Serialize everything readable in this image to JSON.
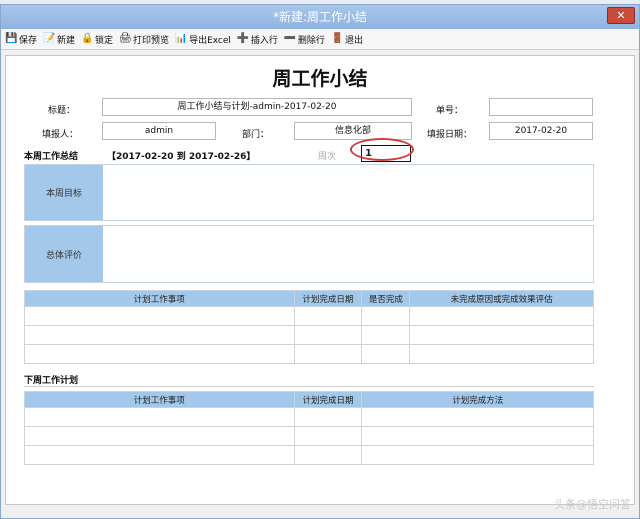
{
  "window": {
    "title": "*新建:周工作小结",
    "close_label": "✕"
  },
  "toolbar": [
    {
      "name": "save",
      "icon": "save-icon",
      "glyph": "💾",
      "label": "保存"
    },
    {
      "name": "new",
      "icon": "new-doc-icon",
      "glyph": "📝",
      "label": "新建"
    },
    {
      "name": "lock",
      "icon": "lock-icon",
      "glyph": "🔒",
      "label": "锁定"
    },
    {
      "name": "print-preview",
      "icon": "print-preview-icon",
      "glyph": "🖨",
      "label": "打印预览"
    },
    {
      "name": "export-excel",
      "icon": "excel-icon",
      "glyph": "📊",
      "label": "导出Excel"
    },
    {
      "name": "insert-row",
      "icon": "insert-row-icon",
      "glyph": "➕",
      "label": "插入行"
    },
    {
      "name": "delete-row",
      "icon": "delete-row-icon",
      "glyph": "➖",
      "label": "删除行"
    },
    {
      "name": "exit",
      "icon": "exit-icon",
      "glyph": "🚪",
      "label": "退出"
    }
  ],
  "form": {
    "heading": "周工作小结",
    "title_label": "标题：",
    "title_value": "周工作小结与计划-admin-2017-02-20",
    "number_label": "单号：",
    "number_value": "",
    "reporter_label": "填报人：",
    "reporter_value": "admin",
    "dept_label": "部门：",
    "dept_value": "信息化部",
    "date_label": "填报日期：",
    "date_value": "2017-02-20"
  },
  "summary": {
    "section_title": "本周工作总结",
    "range": "【2017-02-20 到 2017-02-26】",
    "week_label": "周次",
    "week_value": "1",
    "goal_label": "本周目标",
    "eval_label": "总体评价"
  },
  "plan_table": {
    "columns": [
      "计划工作事项",
      "计划完成日期",
      "是否完成",
      "未完成原因或完成效果评估"
    ],
    "rows": [
      [
        "",
        "",
        "",
        ""
      ],
      [
        "",
        "",
        "",
        ""
      ],
      [
        "",
        "",
        "",
        ""
      ]
    ]
  },
  "next_week": {
    "section_title": "下周工作计划",
    "columns": [
      "计划工作事项",
      "计划完成日期",
      "计划完成方法"
    ],
    "rows": [
      [
        "",
        "",
        ""
      ],
      [
        "",
        "",
        ""
      ],
      [
        "",
        "",
        ""
      ]
    ]
  },
  "watermark": "头条@悟空问答"
}
